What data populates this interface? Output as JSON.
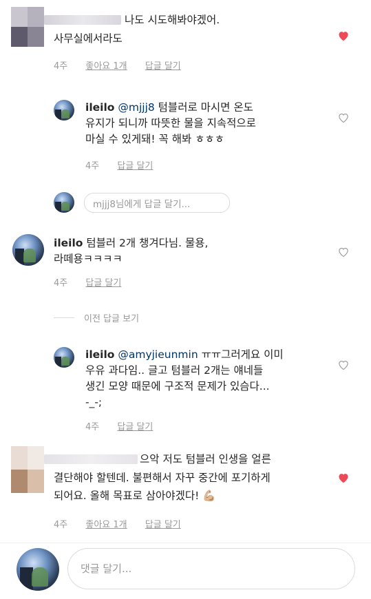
{
  "comments": [
    {
      "text_lines": [
        "나도 시도해봐야겠어.",
        "사무실에서라도"
      ],
      "time": "4주",
      "likes": "좋아요 1개",
      "reply": "답글 달기",
      "liked": true
    },
    {
      "username": "ileilo",
      "mention": "@mjjj8",
      "text_first": " 텀블러로 마시면 온도",
      "text_lines": [
        "유지가 되니까 따뜻한 물을 지속적으로",
        "마실 수 있게돼! 꼭 해봐 ㅎㅎㅎ"
      ],
      "time": "4주",
      "reply": "답글 달기",
      "liked": false
    },
    {
      "username": "ileilo",
      "text_first": " 텀블러 2개 챙겨다님. 물용,",
      "text_lines": [
        "라떼용ㅋㅋㅋㅋ"
      ],
      "time": "4주",
      "reply": "답글 달기",
      "liked": false
    },
    {
      "username": "ileilo",
      "mention": "@amyjieunmin",
      "text_first": " ㅠㅠ그러게요 이미",
      "text_lines": [
        "우유 과다임.. 글고 텀블러 2개는 얘네들",
        "생긴 모양 때문에 구조적 문제가 있슴다...",
        "-_-;"
      ],
      "time": "4주",
      "reply": "답글 달기",
      "liked": false
    },
    {
      "text_first": "으악 저도 텀블러 인생을 얼른",
      "text_lines": [
        "결단해야 할텐데. 불편해서 자꾸 중간에 포기하게",
        "되어요. 올해 목표로 삼아야겠다! 💪🏼"
      ],
      "time": "4주",
      "likes": "좋아요 1개",
      "reply": "답글 달기",
      "liked": true
    }
  ],
  "reply_input_placeholder": "mjjj8님에게 답글 달기...",
  "view_previous_replies": "이전 답글 보기",
  "comment_input_placeholder": "댓글 달기...",
  "colors": {
    "heart_liked": "#ed4956",
    "mention": "#003569",
    "meta": "#999999"
  }
}
